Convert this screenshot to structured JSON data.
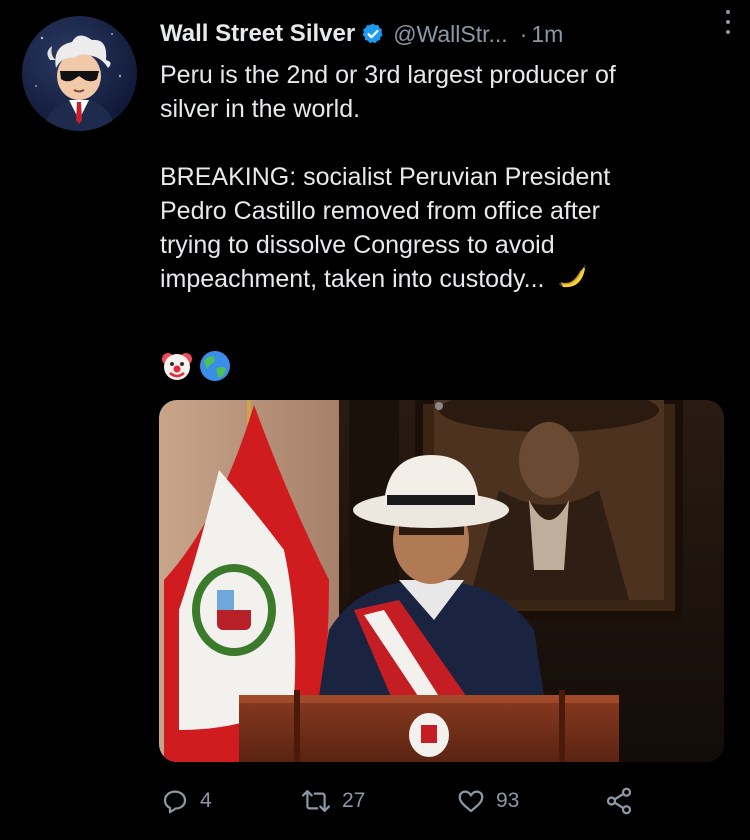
{
  "tweet": {
    "author_name": "Wall Street Silver",
    "handle": "@WallStr...",
    "separator": "·",
    "time": "1m",
    "text_line1": "Peru is the 2nd or 3rd largest producer of",
    "text_line2": "silver in the world.",
    "text_line3": "BREAKING: socialist Peruvian President",
    "text_line4": "Pedro Castillo removed from office after",
    "text_line5": "trying to dissolve Congress to avoid",
    "text_line6": "impeachment, taken into custody...",
    "emojis": [
      "banana",
      "clown-face",
      "globe"
    ]
  },
  "actions": {
    "reply_count": "4",
    "retweet_count": "27",
    "like_count": "93"
  },
  "colors": {
    "background": "#000000",
    "text": "#e7e9ea",
    "secondary": "#8b98a5",
    "verified_badge": "#1d9bf0",
    "flag_red": "#d01c1f"
  },
  "icons": [
    "verified-badge-icon",
    "more-options-icon",
    "reply-icon",
    "retweet-icon",
    "like-icon",
    "share-icon"
  ]
}
